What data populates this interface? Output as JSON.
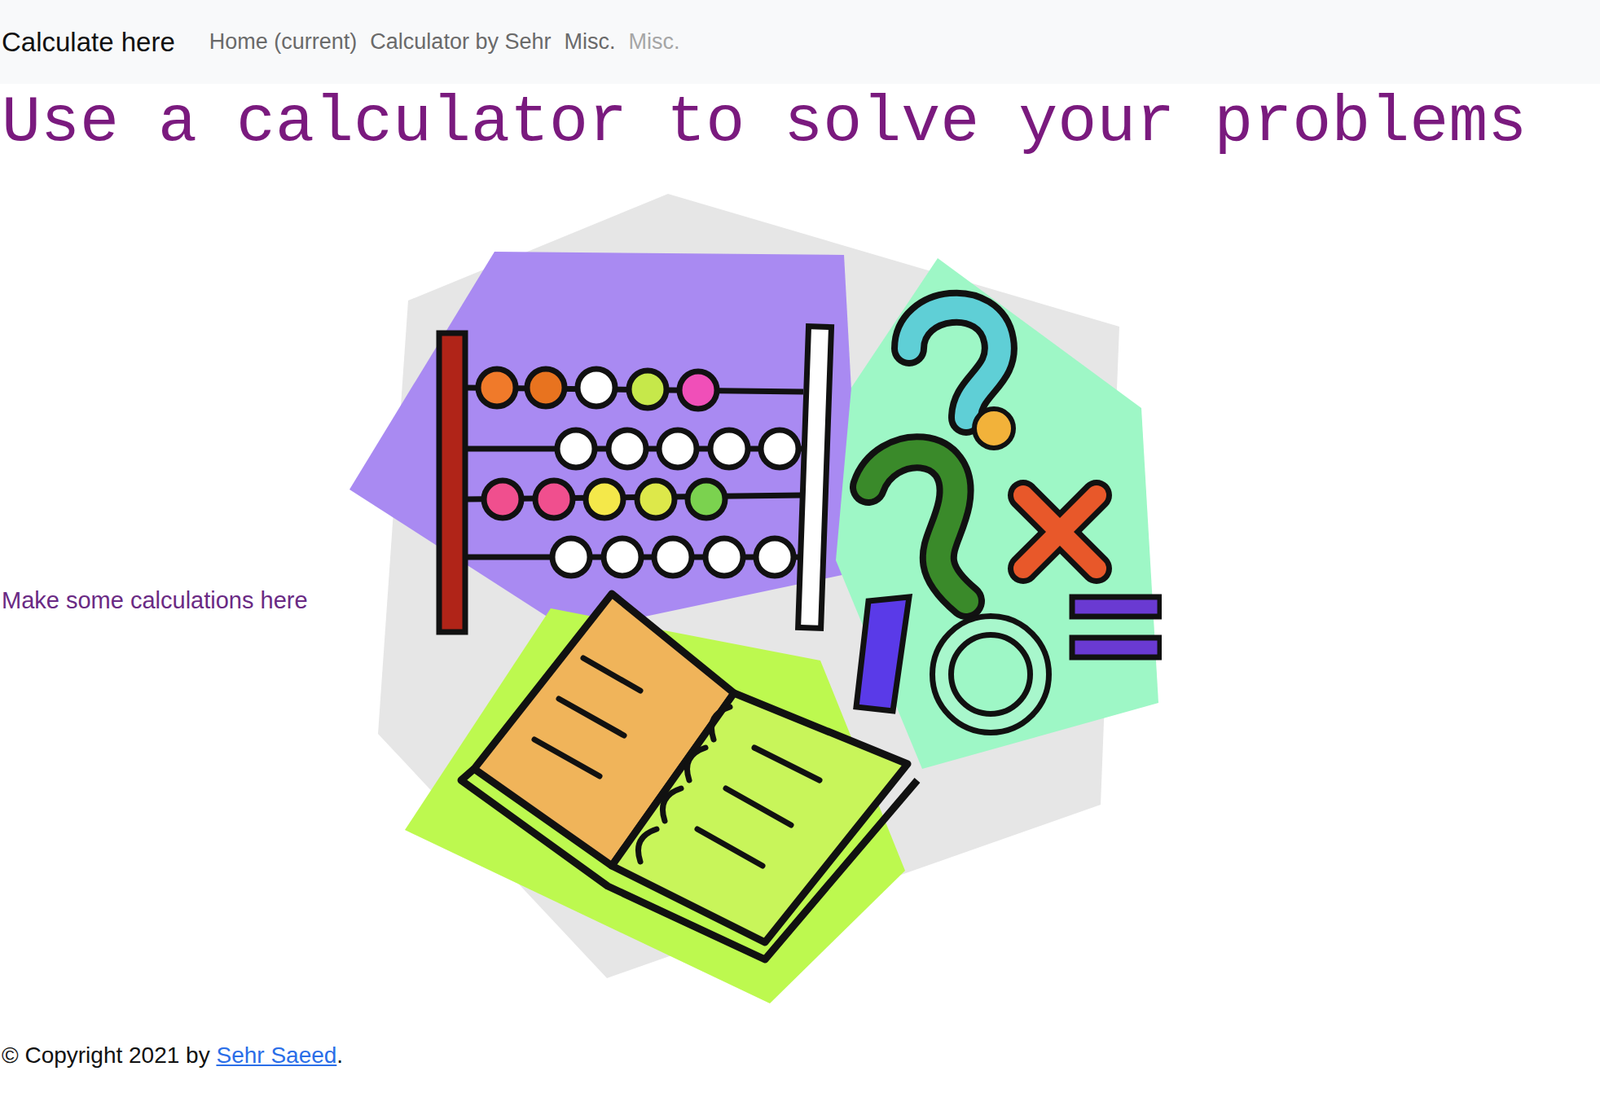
{
  "navbar": {
    "brand": "Calculate here",
    "links": [
      {
        "label": "Home (current)",
        "selected": false,
        "disabled": false
      },
      {
        "label": "Calculator by Sehr",
        "selected": false,
        "disabled": false
      },
      {
        "label": "Misc.",
        "selected": false,
        "disabled": false
      },
      {
        "label": "Misc.",
        "selected": false,
        "disabled": true
      }
    ]
  },
  "heading": "Use a calculator to solve your problems",
  "caption": "Make some calculations here",
  "footer": {
    "prefix": "© Copyright 2021 by ",
    "link": "Sehr Saeed",
    "suffix": "."
  }
}
